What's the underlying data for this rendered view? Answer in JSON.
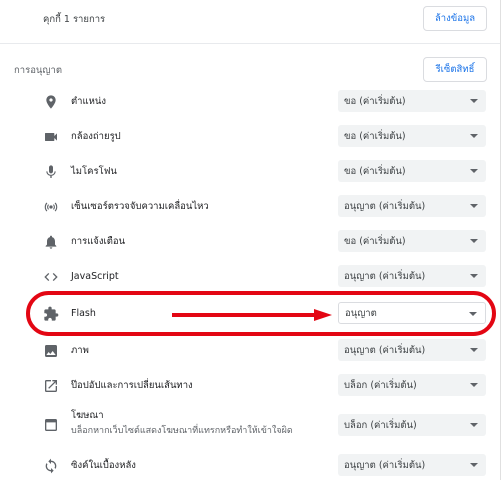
{
  "cookies": {
    "count_text": "คุกกี้ 1 รายการ",
    "clear_label": "ล้างข้อมูล"
  },
  "permissions": {
    "title": "การอนุญาต",
    "reset_label": "รีเซ็ตสิทธิ์",
    "rows": [
      {
        "icon": "location-pin-icon",
        "label": "ตำแหน่ง",
        "value": "ขอ (ค่าเริ่มต้น)"
      },
      {
        "icon": "camera-icon",
        "label": "กล้องถ่ายรูป",
        "value": "ขอ (ค่าเริ่มต้น)"
      },
      {
        "icon": "microphone-icon",
        "label": "ไมโครโฟน",
        "value": "ขอ (ค่าเริ่มต้น)"
      },
      {
        "icon": "motion-sensor-icon",
        "label": "เซ็นเซอร์ตรวจจับความเคลื่อนไหว",
        "value": "อนุญาต (ค่าเริ่มต้น)"
      },
      {
        "icon": "bell-icon",
        "label": "การแจ้งเตือน",
        "value": "ขอ (ค่าเริ่มต้น)"
      },
      {
        "icon": "code-icon",
        "label": "JavaScript",
        "value": "อนุญาต (ค่าเริ่มต้น)"
      },
      {
        "icon": "puzzle-piece-icon",
        "label": "Flash",
        "value": "อนุญาต"
      },
      {
        "icon": "image-icon",
        "label": "ภาพ",
        "value": "อนุญาต (ค่าเริ่มต้น)"
      },
      {
        "icon": "popup-icon",
        "label": "ป๊อปอัปและการเปลี่ยนเส้นทาง",
        "value": "บล็อก (ค่าเริ่มต้น)"
      },
      {
        "icon": "ads-icon",
        "label": "โฆษณา",
        "sublabel": "บล็อกหากเว็บไซต์แสดงโฆษณาที่แทรกหรือทำให้เข้าใจผิด",
        "value": "บล็อก (ค่าเริ่มต้น)"
      },
      {
        "icon": "sync-icon",
        "label": "ซิงค์ในเบื้องหลัง",
        "value": "อนุญาต (ค่าเริ่มต้น)"
      }
    ]
  },
  "colors": {
    "accent": "#1a73e8",
    "highlight": "#e30613"
  }
}
